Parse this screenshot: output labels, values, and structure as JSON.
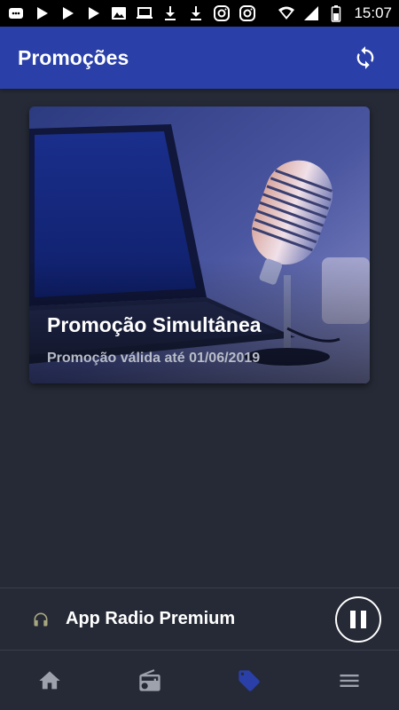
{
  "status_bar": {
    "time": "15:07",
    "notification_icons": [
      "chat-icon",
      "play-icon",
      "play-icon",
      "play-icon",
      "image-icon",
      "laptop-icon",
      "download-icon",
      "download-icon",
      "instagram-icon",
      "instagram-icon"
    ],
    "system_icons": [
      "wifi-icon",
      "signal-icon",
      "battery-icon"
    ]
  },
  "app_bar": {
    "title": "Promoções",
    "refresh_icon": "refresh-icon"
  },
  "promotions": [
    {
      "title": "Promoção Simultânea",
      "subtitle": "Promoção válida até 01/06/2019",
      "image": "microphone-laptop-photo"
    }
  ],
  "player": {
    "station": "App Radio Premium",
    "state_icon": "pause-icon"
  },
  "bottom_nav": {
    "items": [
      {
        "icon": "home-icon",
        "active": false
      },
      {
        "icon": "radio-icon",
        "active": false
      },
      {
        "icon": "tag-icon",
        "active": true
      },
      {
        "icon": "menu-icon",
        "active": false
      }
    ]
  },
  "colors": {
    "app_bar": "#2a40a8",
    "background": "#262a36",
    "nav_active": "#2a40a8",
    "nav_inactive": "#9ea2ad"
  }
}
